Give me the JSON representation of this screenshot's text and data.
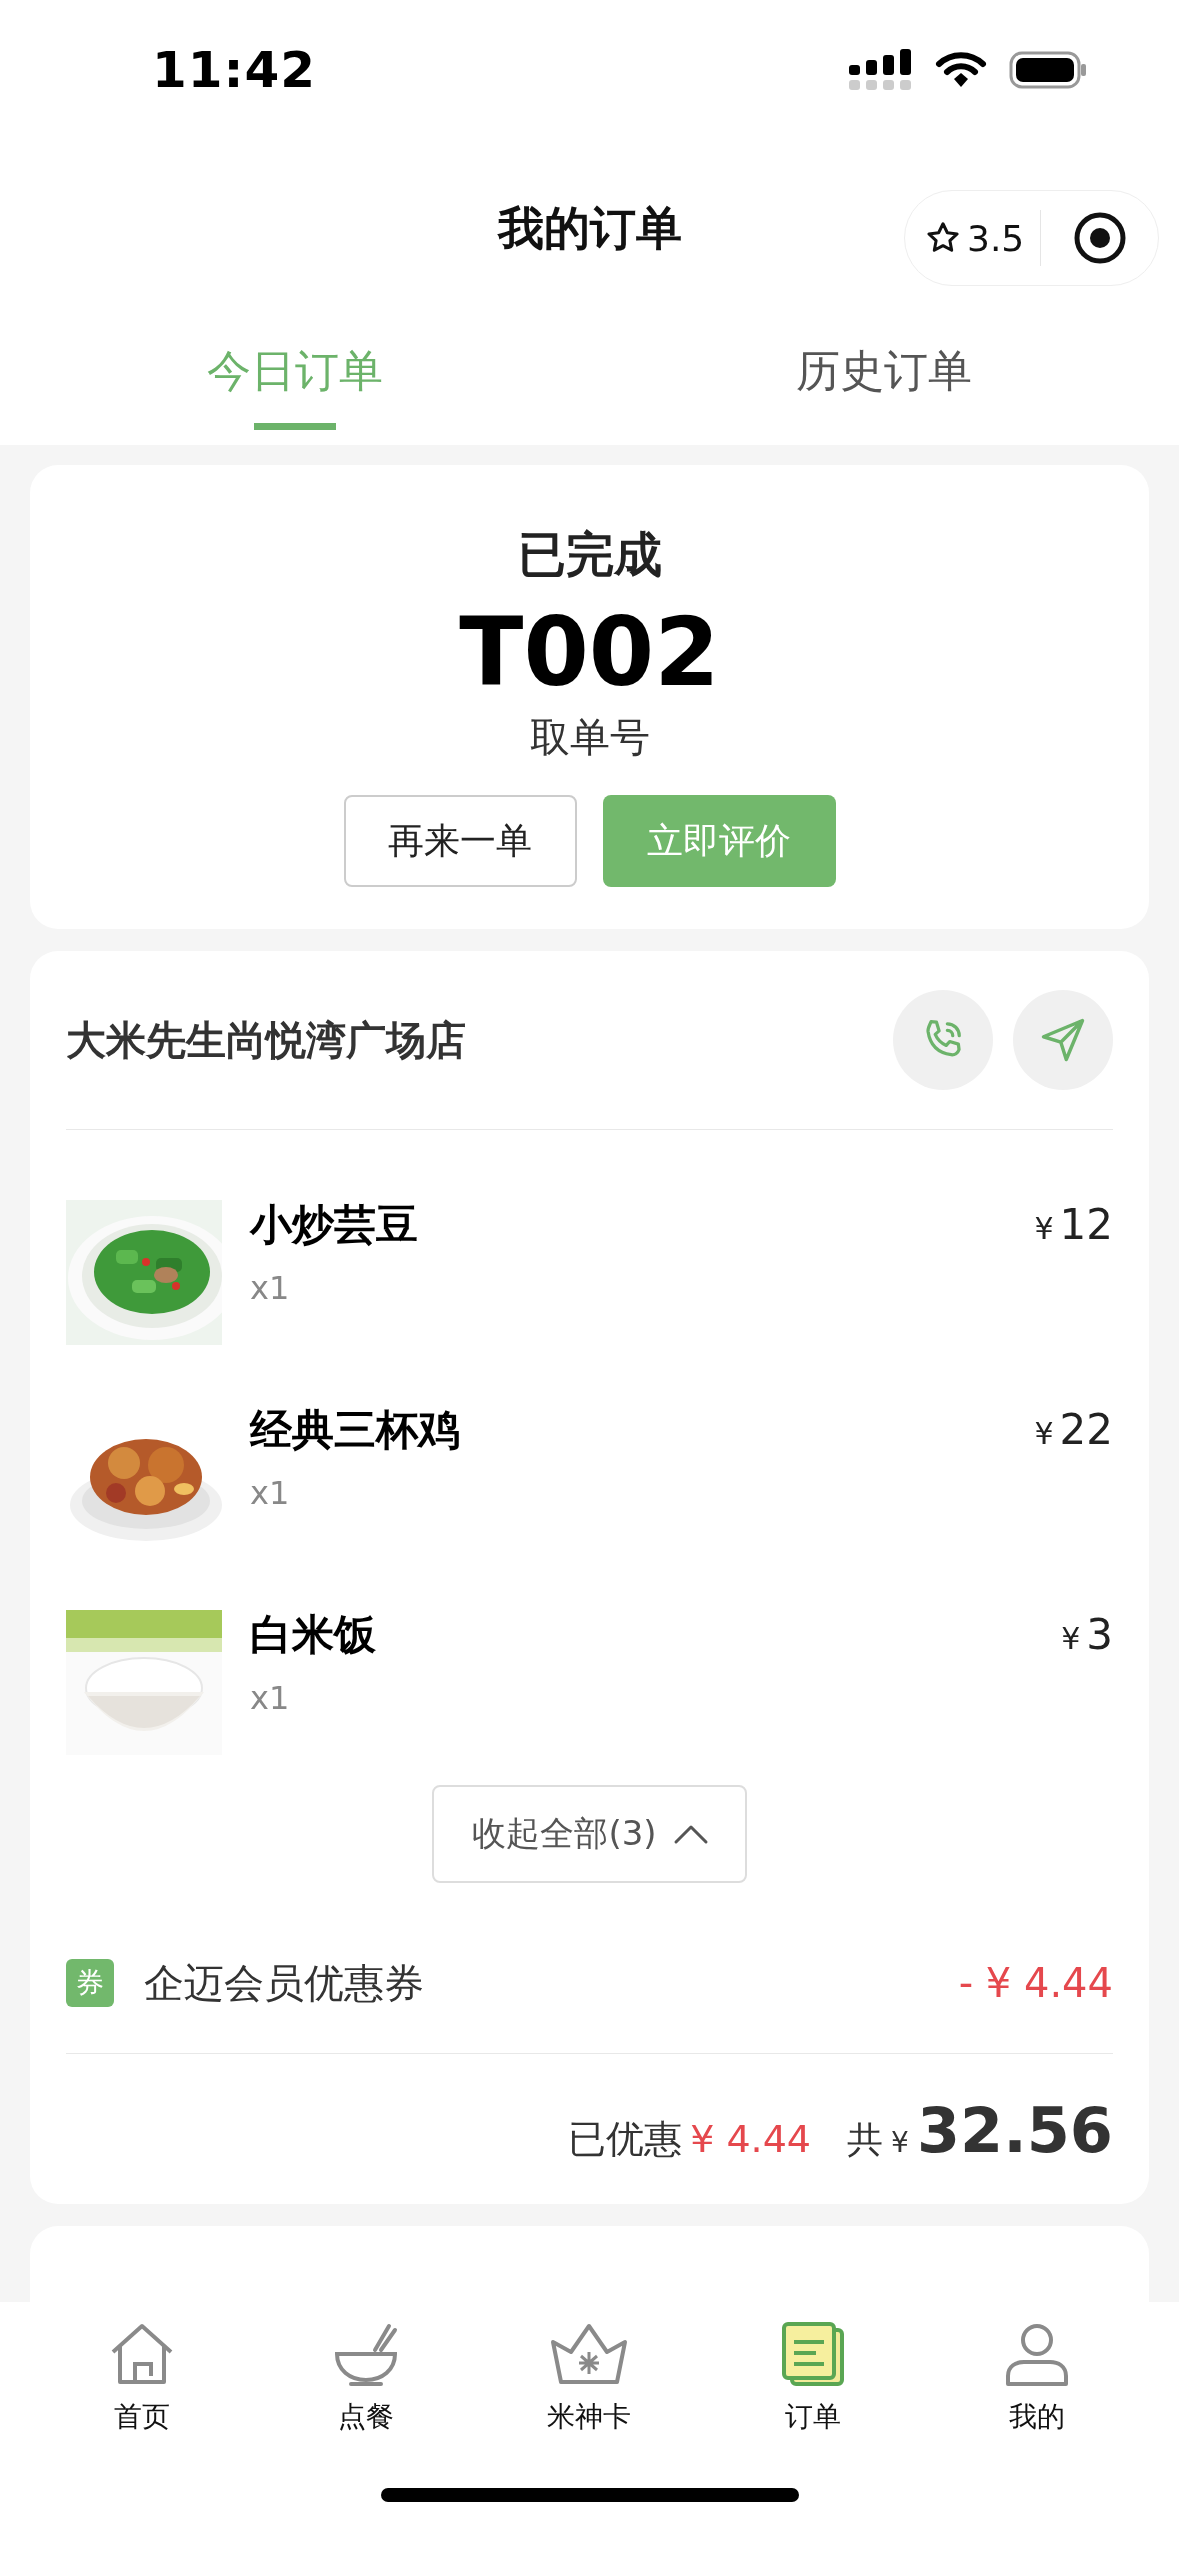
{
  "status_bar": {
    "time": "11:42"
  },
  "header": {
    "title": "我的订单",
    "rating": "3.5"
  },
  "tabs": [
    {
      "label": "今日订单",
      "selected": true
    },
    {
      "label": "历史订单",
      "selected": false
    }
  ],
  "order": {
    "status": "已完成",
    "pickup_number": "T002",
    "pickup_label": "取单号",
    "buttons": [
      {
        "label": "再来一单",
        "kind": "outline"
      },
      {
        "label": "立即评价",
        "kind": "primary"
      }
    ]
  },
  "store": {
    "name": "大米先生尚悦湾广场店",
    "items": [
      {
        "name": "小炒芸豆",
        "quantity": "x1",
        "currency": "¥",
        "price": "12"
      },
      {
        "name": "经典三杯鸡",
        "quantity": "x1",
        "currency": "¥",
        "price": "22"
      },
      {
        "name": "白米饭",
        "quantity": "x1",
        "currency": "¥",
        "price": "3"
      }
    ],
    "collapse_button": "收起全部(3)",
    "coupon": {
      "badge": "券",
      "name": "企迈会员优惠券",
      "amount": "- ¥ 4.44"
    },
    "summary": {
      "discount_label": "已优惠",
      "discount": "¥ 4.44",
      "total_label": "共",
      "total_currency": "¥",
      "total": "32.56"
    }
  },
  "tab_bar": [
    {
      "label": "首页",
      "selected": false
    },
    {
      "label": "点餐",
      "selected": false
    },
    {
      "label": "米神卡",
      "selected": false
    },
    {
      "label": "订单",
      "selected": true
    },
    {
      "label": "我的",
      "selected": false
    }
  ]
}
